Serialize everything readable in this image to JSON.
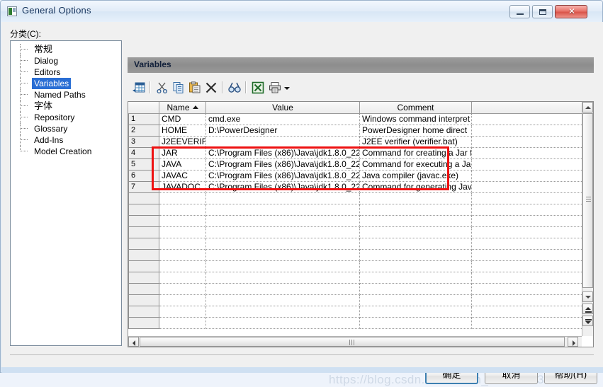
{
  "window": {
    "title": "General Options",
    "icon": "app-icon",
    "buttons": {
      "minimize": "–",
      "maximize": "□",
      "close": "✕"
    }
  },
  "sidebar": {
    "label": "分类(C):",
    "items": [
      {
        "label": "常规",
        "selected": false,
        "cjk": true
      },
      {
        "label": "Dialog",
        "selected": false,
        "cjk": false
      },
      {
        "label": "Editors",
        "selected": false,
        "cjk": false
      },
      {
        "label": "Variables",
        "selected": true,
        "cjk": false
      },
      {
        "label": "Named Paths",
        "selected": false,
        "cjk": false
      },
      {
        "label": "字体",
        "selected": false,
        "cjk": true
      },
      {
        "label": "Repository",
        "selected": false,
        "cjk": false
      },
      {
        "label": "Glossary",
        "selected": false,
        "cjk": false
      },
      {
        "label": "Add-Ins",
        "selected": false,
        "cjk": false
      },
      {
        "label": "Model Creation",
        "selected": false,
        "cjk": false
      }
    ]
  },
  "panel": {
    "title": "Variables"
  },
  "toolbar": {
    "items": [
      {
        "name": "insert-row-icon",
        "title": "Insert a Row"
      },
      {
        "name": "cut-icon",
        "title": "Cut"
      },
      {
        "name": "copy-icon",
        "title": "Copy"
      },
      {
        "name": "paste-icon",
        "title": "Paste"
      },
      {
        "name": "delete-icon",
        "title": "Delete"
      },
      {
        "name": "find-icon",
        "title": "Find"
      },
      {
        "name": "excel-export-icon",
        "title": "Export to Excel"
      },
      {
        "name": "print-icon",
        "title": "Print"
      },
      {
        "name": "chevron-down-icon",
        "title": "More"
      }
    ]
  },
  "grid": {
    "columns": [
      {
        "key": "rownum",
        "label": ""
      },
      {
        "key": "name",
        "label": "Name",
        "sorted": "asc"
      },
      {
        "key": "value",
        "label": "Value"
      },
      {
        "key": "comment",
        "label": "Comment"
      },
      {
        "key": "extra",
        "label": ""
      }
    ],
    "sort_indicator": "▲",
    "rows": [
      {
        "num": "1",
        "name": "CMD",
        "value": "cmd.exe",
        "comment": "Windows command interpret",
        "highlighted": false
      },
      {
        "num": "2",
        "name": "HOME",
        "value": "D:\\PowerDesigner",
        "comment": "PowerDesigner home direct",
        "highlighted": false
      },
      {
        "num": "3",
        "name": "J2EEVERIF",
        "value": "",
        "comment": "J2EE verifier (verifier.bat)",
        "highlighted": false
      },
      {
        "num": "4",
        "name": "JAR",
        "value": "C:\\Program Files (x86)\\Java\\jdk1.8.0_22",
        "comment": "Command for creating a Jar f",
        "highlighted": true
      },
      {
        "num": "5",
        "name": "JAVA",
        "value": "C:\\Program Files (x86)\\Java\\jdk1.8.0_22",
        "comment": "Command for executing a Ja",
        "highlighted": true
      },
      {
        "num": "6",
        "name": "JAVAC",
        "value": "C:\\Program Files (x86)\\Java\\jdk1.8.0_22",
        "comment": "Java compiler (javac.exe)",
        "highlighted": true
      },
      {
        "num": "7",
        "name": "JAVADOC",
        "value": "C:\\Program Files (x86)\\Java\\jdk1.8.0_22",
        "comment": "Command for generating Jav",
        "highlighted": true
      },
      {
        "num": "",
        "name": "",
        "value": "",
        "comment": "",
        "highlighted": false
      },
      {
        "num": "",
        "name": "",
        "value": "",
        "comment": "",
        "highlighted": false
      },
      {
        "num": "",
        "name": "",
        "value": "",
        "comment": "",
        "highlighted": false
      },
      {
        "num": "",
        "name": "",
        "value": "",
        "comment": "",
        "highlighted": false
      },
      {
        "num": "",
        "name": "",
        "value": "",
        "comment": "",
        "highlighted": false
      },
      {
        "num": "",
        "name": "",
        "value": "",
        "comment": "",
        "highlighted": false
      },
      {
        "num": "",
        "name": "",
        "value": "",
        "comment": "",
        "highlighted": false
      },
      {
        "num": "",
        "name": "",
        "value": "",
        "comment": "",
        "highlighted": false
      },
      {
        "num": "",
        "name": "",
        "value": "",
        "comment": "",
        "highlighted": false
      },
      {
        "num": "",
        "name": "",
        "value": "",
        "comment": "",
        "highlighted": false
      },
      {
        "num": "",
        "name": "",
        "value": "",
        "comment": "",
        "highlighted": false
      },
      {
        "num": "",
        "name": "",
        "value": "",
        "comment": "",
        "highlighted": false
      }
    ],
    "highlight_color": "#ee1111"
  },
  "footer": {
    "ok_label": "确定",
    "cancel_label": "取消",
    "help_label": "帮助(H)",
    "watermark": "https://blog.csdn.net/weixin_43331673"
  }
}
